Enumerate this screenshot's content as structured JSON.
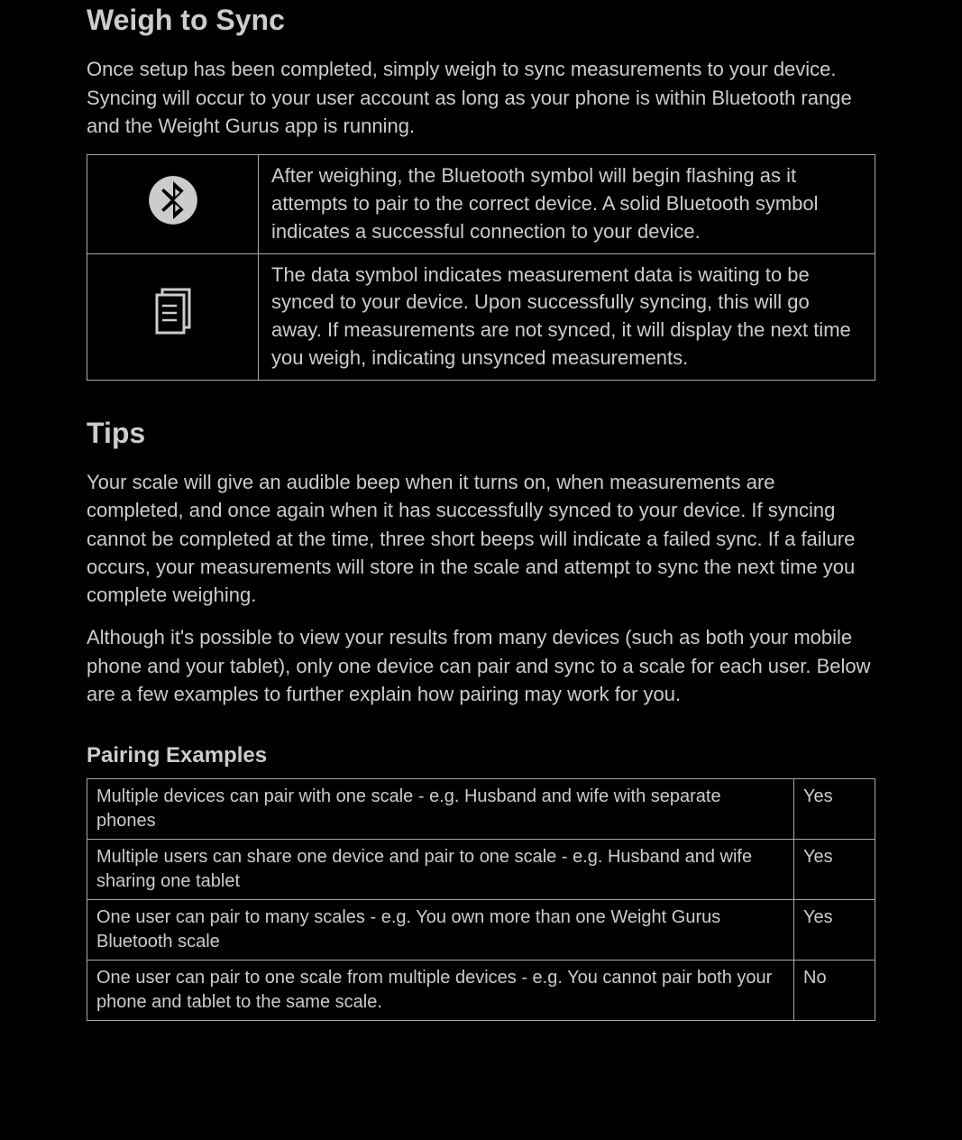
{
  "section1": {
    "heading": "Weigh to Sync",
    "intro": "Once setup has been completed, simply weigh to sync measurements to your device.  Syncing will occur to your user account as long as your phone is within Bluetooth range and the Weight Gurus app is running."
  },
  "icon_table": [
    {
      "icon": "bluetooth",
      "text": "After weighing, the Bluetooth symbol will begin flashing as it attempts to pair to the correct device.  A solid Bluetooth symbol indicates a successful connection to your device."
    },
    {
      "icon": "document",
      "text": "The data symbol indicates measurement data is waiting to be synced to your device.  Upon successfully syncing, this will go away.  If measurements are not synced, it will display the next time you weigh, indicating unsynced measurements."
    }
  ],
  "section2": {
    "heading": "Tips",
    "para1": "Your scale will give an audible beep when it turns on, when measurements are completed, and once again when it has successfully synced to your device.  If syncing cannot be completed at the time, three short beeps will indicate a failed sync.  If a failure occurs, your measurements will store in the scale and attempt to sync the next time you complete weighing.",
    "para2": "Although it's possible to view your results from many devices (such as both your mobile phone and your tablet), only one device can pair and sync to a scale for each user.  Below are a few examples to further explain how pairing may work for you."
  },
  "pairing": {
    "heading": "Pairing Examples",
    "rows": [
      {
        "desc": "Multiple devices can pair with one scale  - e.g. Husband and wife with separate phones",
        "answer": "Yes"
      },
      {
        "desc": "Multiple users can share one device and pair to one scale - e.g. Husband and wife sharing one tablet",
        "answer": "Yes"
      },
      {
        "desc": "One user can pair to many scales - e.g. You own more than one Weight Gurus Bluetooth scale",
        "answer": "Yes"
      },
      {
        "desc": "One user can pair to one scale from multiple devices - e.g. You cannot pair both your phone and tablet to the same scale.",
        "answer": "No"
      }
    ]
  }
}
